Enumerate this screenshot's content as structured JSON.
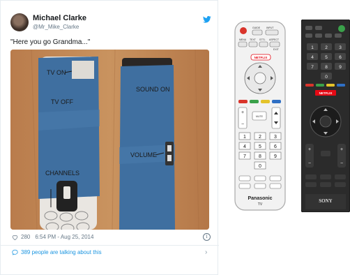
{
  "tweet": {
    "author_name": "Michael Clarke",
    "author_handle": "@Mr_Mike_Clarke",
    "text": "\"Here you go Grandma...\"",
    "likes": "280",
    "timestamp": "6:54 PM - Aug 25, 2014",
    "talking": "389 people are talking about this"
  },
  "photo_labels": {
    "tv_on": "TV ON",
    "tv_off": "TV OFF",
    "channels": "CHANNELS",
    "sound_on": "SOUND ON",
    "volume": "VOLUME"
  },
  "remote_white": {
    "brand": "Panasonic",
    "model": "TV",
    "netflix": "NETFLIX",
    "top_labels": [
      "GUIDE",
      "INPUT",
      "MENU",
      "TEXT",
      "STTL",
      "ASPECT",
      "EXIT"
    ],
    "numbers": [
      "1",
      "2",
      "3",
      "4",
      "5",
      "6",
      "7",
      "8",
      "9",
      "0"
    ],
    "mute": "MUTE"
  },
  "remote_black": {
    "brand": "SONY",
    "netflix": "NETFLIX",
    "numbers": [
      "1",
      "2",
      "3",
      "4",
      "5",
      "6",
      "7",
      "8",
      "9",
      "0"
    ]
  },
  "colors": {
    "twitter_blue": "#1da1f2",
    "link_blue": "#1b95e0",
    "tape_blue": "#3f6fa0",
    "wood": "#c08a5a",
    "netflix_red": "#e50914"
  }
}
